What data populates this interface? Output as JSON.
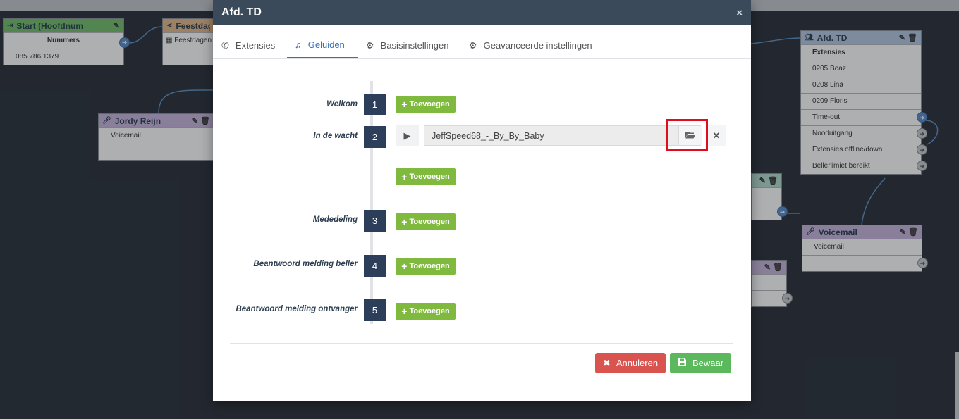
{
  "canvas": {
    "start_node": {
      "title": "Start (Hoofdnum",
      "subheader": "Nummers",
      "rows": [
        "085 786 1379"
      ]
    },
    "holiday_node": {
      "title": "Feestdag",
      "rows": [
        "Feestdagen"
      ]
    },
    "jordy_node": {
      "title": "Jordy Reijn",
      "rows": [
        "Voicemail",
        ""
      ]
    },
    "afd_node": {
      "title": "Afd. TD",
      "subheader": "Extensies",
      "rows": [
        "0205 Boaz",
        "0208 Lina",
        "0209 Floris",
        "Time-out",
        "Nooduitgang",
        "Extensies offline/down",
        "Bellerlimiet bereikt"
      ]
    },
    "voicemail_node": {
      "title": "Voicemail",
      "rows": [
        "Voicemail",
        ""
      ]
    }
  },
  "modal": {
    "title": "Afd. TD",
    "close": "×",
    "tabs": [
      {
        "label": "Extensies",
        "icon": "phone-icon"
      },
      {
        "label": "Geluiden",
        "icon": "music-icon",
        "active": true
      },
      {
        "label": "Basisinstellingen",
        "icon": "gear-icon"
      },
      {
        "label": "Geavanceerde instellingen",
        "icon": "gear-icon"
      }
    ],
    "sounds": [
      {
        "label": "Welkom",
        "num": "1"
      },
      {
        "label": "In de wacht",
        "num": "2"
      },
      {
        "label": "Mededeling",
        "num": "3"
      },
      {
        "label": "Beantwoord melding beller",
        "num": "4"
      },
      {
        "label": "Beantwoord melding ontvanger",
        "num": "5"
      }
    ],
    "add_label": "Toevoegen",
    "hold_file": "JeffSpeed68_-_By_By_Baby",
    "cancel_label": "Annuleren",
    "save_label": "Bewaar"
  },
  "colors": {
    "header": "#3b4a5a",
    "accent": "#3a6fb0",
    "add_green": "#7fba3f",
    "cancel_red": "#d9534f",
    "save_green": "#5cb85c",
    "highlight": "#e00d1d"
  }
}
